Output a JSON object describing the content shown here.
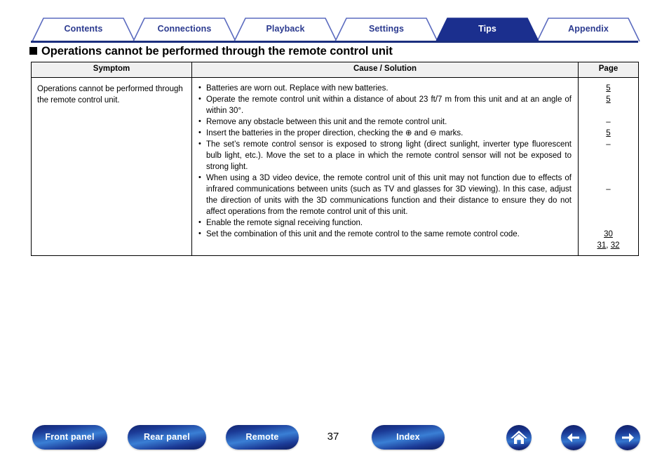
{
  "tabs": [
    {
      "label": "Contents",
      "active": false
    },
    {
      "label": "Connections",
      "active": false
    },
    {
      "label": "Playback",
      "active": false
    },
    {
      "label": "Settings",
      "active": false
    },
    {
      "label": "Tips",
      "active": true
    },
    {
      "label": "Appendix",
      "active": false
    }
  ],
  "heading": "Operations cannot be performed through the remote control unit",
  "table": {
    "headers": {
      "symptom": "Symptom",
      "cause": "Cause / Solution",
      "page": "Page"
    },
    "row": {
      "symptom": "Operations cannot be performed through the remote control unit.",
      "causes": [
        "Batteries are worn out. Replace with new batteries.",
        "Operate the remote control unit within a distance of about 23 ft/7 m from this unit and at an angle of within 30°.",
        "Remove any obstacle between this unit and the remote control unit.",
        "Insert the batteries in the proper direction, checking the ⊕ and ⊖ marks.",
        "The set’s remote control sensor is exposed to strong light (direct sunlight, inverter type fluorescent bulb light, etc.). Move the set to a place in which the remote control sensor will not be exposed to strong light.",
        "When using a 3D video device, the remote control unit of this unit may not function due to effects of infrared communications between units (such as TV and glasses for 3D viewing). In this case, adjust the direction of units with the 3D communications function and their distance to ensure they do not affect operations from the remote control unit of this unit.",
        "Enable the remote signal receiving function.",
        "Set the combination of this unit and the remote control to the same remote control code."
      ],
      "pages": [
        "5",
        "5",
        "–",
        "5",
        "–",
        "–",
        "30",
        "31",
        "32"
      ]
    }
  },
  "footer": {
    "buttons": [
      {
        "label": "Front panel"
      },
      {
        "label": "Rear panel"
      },
      {
        "label": "Remote"
      },
      {
        "label": "Index"
      }
    ],
    "page_number": "37",
    "icons": [
      {
        "name": "home-icon"
      },
      {
        "name": "back-arrow-icon"
      },
      {
        "name": "forward-arrow-icon"
      }
    ]
  },
  "colors": {
    "tab_active_bg": "#1b2f8e",
    "tab_text": "#2b3a8f",
    "rule": "#1b2f7e",
    "button_blue": "#1b3a96"
  }
}
